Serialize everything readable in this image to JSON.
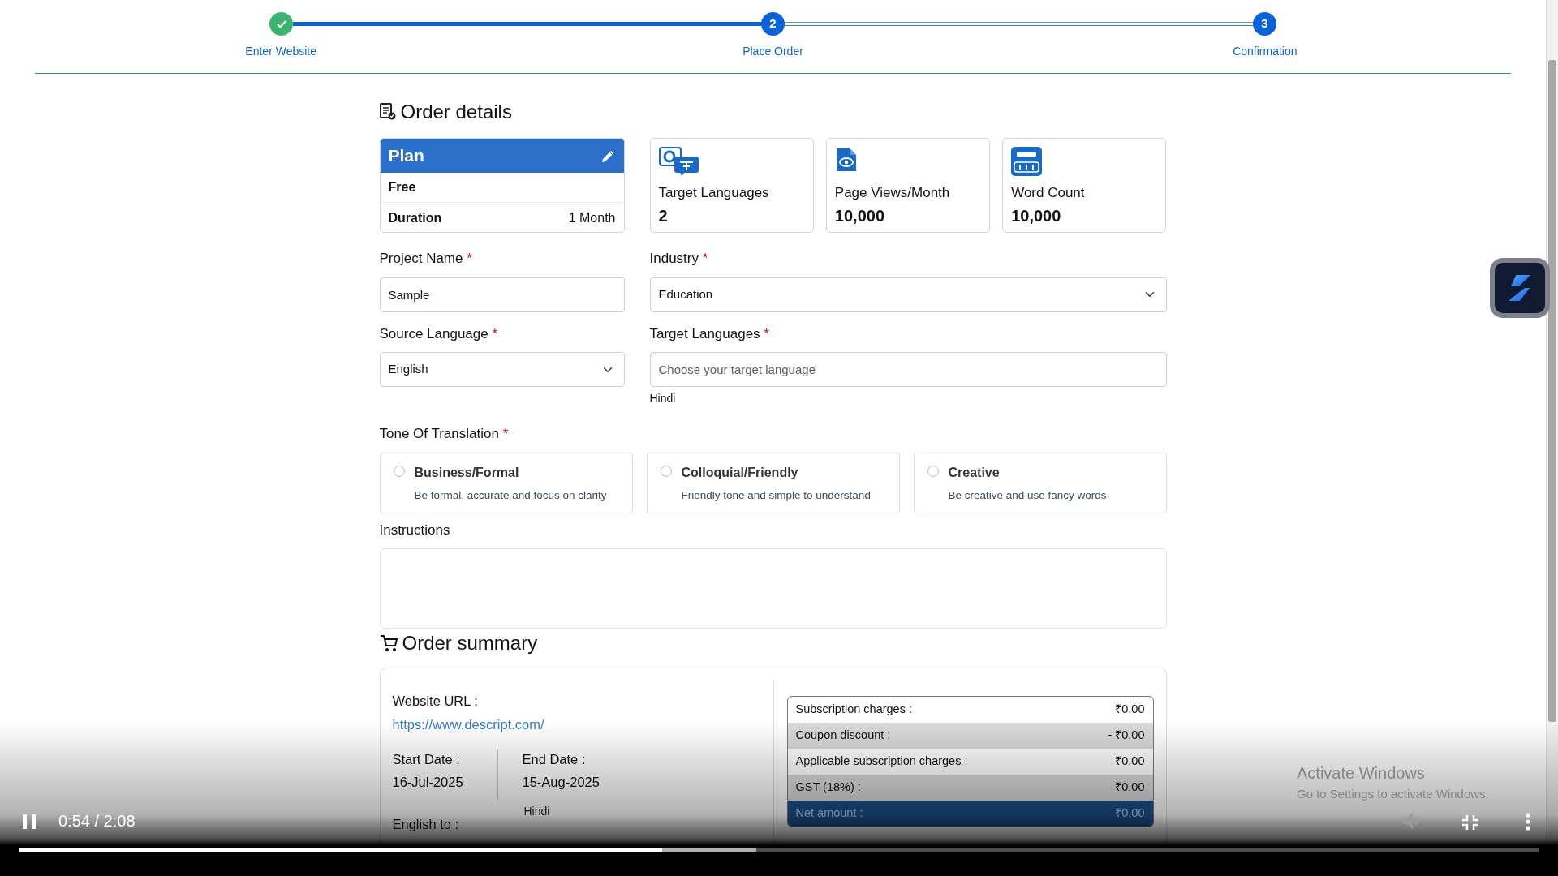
{
  "stepper": {
    "steps": [
      {
        "label": "Enter Website",
        "completed": true
      },
      {
        "label": "Place Order",
        "number": "2",
        "completed": false
      },
      {
        "label": "Confirmation",
        "number": "3",
        "completed": false
      }
    ]
  },
  "order_details": {
    "title": "Order details",
    "plan": {
      "title": "Plan",
      "name": "Free",
      "duration_label": "Duration",
      "duration_value": "1 Month"
    },
    "stats": [
      {
        "kind": "languages",
        "label": "Target Languages",
        "value": "2"
      },
      {
        "kind": "pageviews",
        "label": "Page Views/Month",
        "value": "10,000"
      },
      {
        "kind": "wordcount",
        "label": "Word Count",
        "value": "10,000"
      }
    ]
  },
  "form": {
    "required_mark": "*",
    "project_name": {
      "label": "Project Name",
      "required": true,
      "value": "Sample"
    },
    "industry": {
      "label": "Industry",
      "required": true,
      "value": "Education"
    },
    "source_language": {
      "label": "Source Language",
      "required": true,
      "value": "English"
    },
    "target_languages": {
      "label": "Target Languages",
      "required": true,
      "placeholder": "Choose your target language",
      "chosen": "Hindi"
    }
  },
  "tone": {
    "label": "Tone Of Translation",
    "required": true,
    "options": [
      {
        "title": "Business/Formal",
        "description": "Be formal, accurate and focus on clarity",
        "selected": false
      },
      {
        "title": "Colloquial/Friendly",
        "description": "Friendly tone and simple to understand",
        "selected": false
      },
      {
        "title": "Creative",
        "description": "Be creative and use fancy words",
        "selected": false
      }
    ]
  },
  "instructions": {
    "label": "Instructions"
  },
  "order_summary": {
    "title": "Order summary",
    "website_url_label": "Website URL :",
    "website_url": "https://www.descript.com/",
    "start_date_label": "Start Date :",
    "start_date": "16-Jul-2025",
    "end_date_label": "End Date :",
    "end_date": "15-Aug-2025",
    "pair_label": "English to :",
    "pair_value": "Hindi",
    "charges": [
      {
        "kind": "plain",
        "label": "Subscription charges :",
        "value": "₹0.00"
      },
      {
        "kind": "shaded",
        "label": "Coupon discount :",
        "value": "- ₹0.00"
      },
      {
        "kind": "plain",
        "label": "Applicable subscription charges :",
        "value": "₹0.00"
      },
      {
        "kind": "shaded",
        "label": "GST (18%) :",
        "value": "₹0.00"
      },
      {
        "kind": "total",
        "label": "Net amount :",
        "value": "₹0.00"
      }
    ]
  },
  "player": {
    "playing": true,
    "time": "0:54 / 2:08",
    "played": {
      "level": 0.423
    },
    "buffered": {
      "level": 0.485
    }
  },
  "os_notice": {
    "title": "Activate Windows",
    "subtitle": "Go to Settings to activate Windows."
  }
}
